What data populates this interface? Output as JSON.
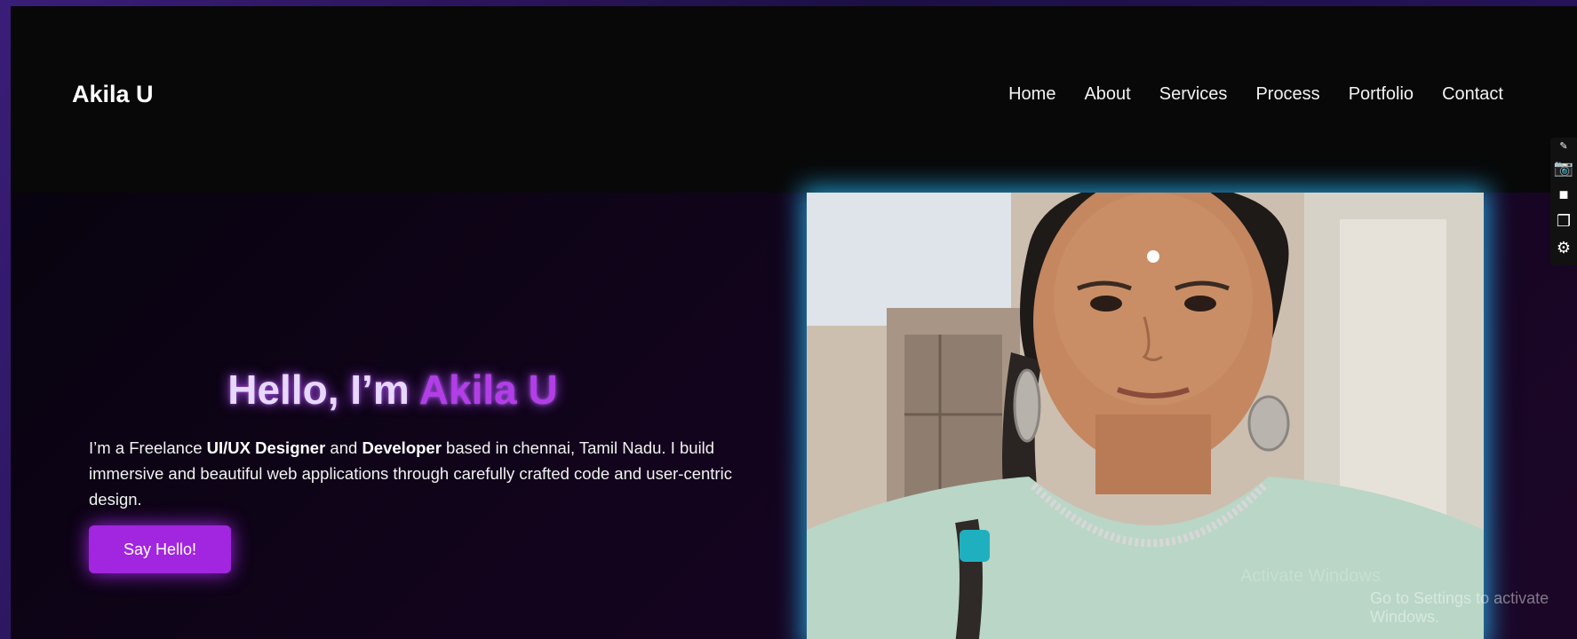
{
  "header": {
    "brand": "Akila U",
    "nav": [
      "Home",
      "About",
      "Services",
      "Process",
      "Portfolio",
      "Contact"
    ]
  },
  "hero": {
    "title_prefix": "Hello, I’m ",
    "title_name": "Akila U",
    "desc_1": "I’m a Freelance ",
    "desc_bold_1": "UI/UX Designer",
    "desc_2": " and ",
    "desc_bold_2": "Developer",
    "desc_3": " based in chennai, Tamil Nadu. I build immersive and beautiful web applications through carefully crafted code and user-centric design.",
    "cta_label": "Say Hello!"
  },
  "overlay": {
    "watermark_line1": "Activate Windows",
    "watermark_line2": "Go to Settings to activate Windows."
  },
  "toolbar": {
    "icons": [
      "pin-icon",
      "camera-icon",
      "video-icon",
      "window-icon",
      "gear-icon"
    ]
  },
  "colors": {
    "accent": "#b33ee8",
    "button": "#a225e0",
    "glow_blue": "#28beff",
    "background": "#080808"
  }
}
